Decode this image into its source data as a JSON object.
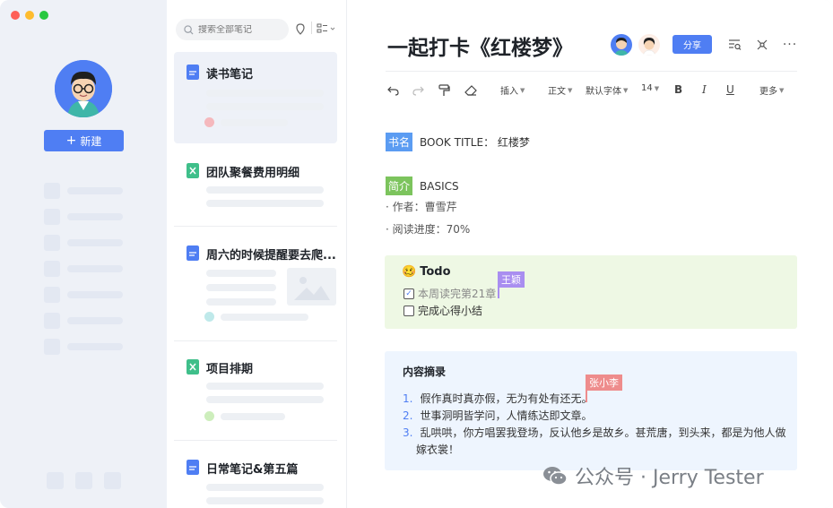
{
  "window": {
    "traffic_colors": [
      "#fe5f57",
      "#febc2e",
      "#28c840"
    ]
  },
  "sidebar": {
    "new_button_label": "新建",
    "new_button_icon": "plus-icon"
  },
  "list": {
    "search_placeholder": "搜索全部笔记",
    "notes": [
      {
        "title": "读书笔记",
        "type": "doc",
        "dot_color": "#f5b8bd"
      },
      {
        "title": "团队聚餐费用明细",
        "type": "sheet"
      },
      {
        "title": "周六的时候提醒要去爬...",
        "type": "doc",
        "dot_color": "#bfe9ea"
      },
      {
        "title": "项目排期",
        "type": "sheet",
        "dot_color": "#cdeebc"
      },
      {
        "title": "日常笔记&第五篇",
        "type": "doc"
      }
    ]
  },
  "editor": {
    "title": "一起打卡《红楼梦》",
    "share_label": "分享",
    "toolbar": {
      "insert": "插入",
      "para": "正文",
      "font": "默认字体",
      "size": "14",
      "more": "更多"
    },
    "book_tag": "书名",
    "book_title_line": "BOOK TITLE：  红楼梦",
    "intro_tag": "简介",
    "intro_label": "BASICS",
    "bullets": [
      "· 作者：曹雪芹",
      "· 阅读进度：70%"
    ],
    "todo": {
      "emoji": "🥴",
      "title": "Todo",
      "items": [
        {
          "text": "本周读完第21章",
          "checked": true
        },
        {
          "text": "完成心得小结",
          "checked": false
        }
      ],
      "cursor_name": "王颖"
    },
    "summary": {
      "title": "内容摘录",
      "items": [
        {
          "num": "1.",
          "text": "假作真时真亦假，无为有处有还无。"
        },
        {
          "num": "2.",
          "text": "世事洞明皆学问，人情练达即文章。"
        },
        {
          "num": "3.",
          "text": "乱哄哄，你方唱罢我登场，反认他乡是故乡。甚荒唐，到头来，都是为他人做"
        },
        {
          "num": "",
          "text": "嫁衣裳！"
        }
      ],
      "cursor_name": "张小李"
    }
  },
  "watermark": "公众号 · Jerry Tester",
  "colors": {
    "accent": "#4f7ef3",
    "book_tag": "#5b9cf2",
    "intro_tag": "#7cc45d",
    "cursor_wang": "#a98ef0",
    "cursor_zhang": "#ee8c8c"
  }
}
